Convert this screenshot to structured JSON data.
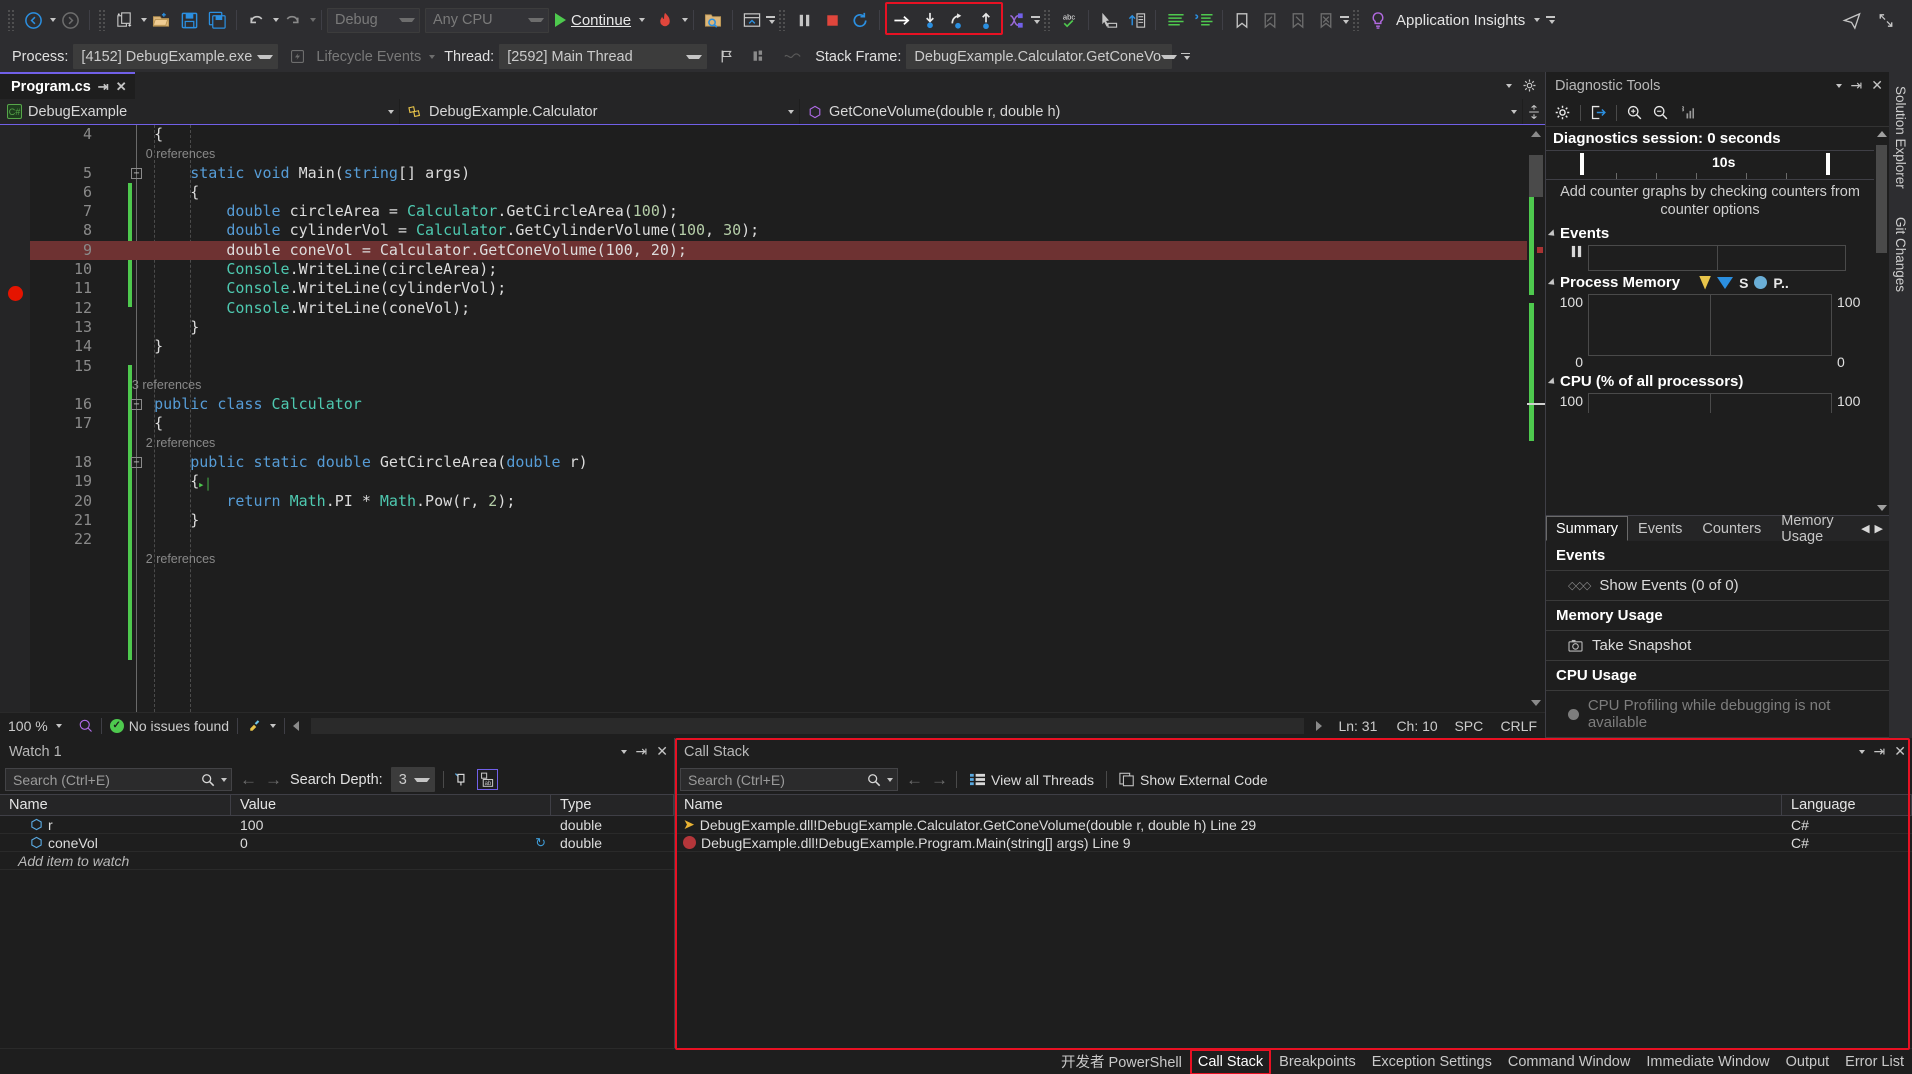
{
  "toolbar": {
    "nav_back_icon": "navigate-back-icon",
    "nav_forward_icon": "navigate-forward-icon",
    "new_item_icon": "new-item-icon",
    "open_file_icon": "open-file-icon",
    "save_icon": "save-icon",
    "save_all_icon": "save-all-icon",
    "undo_icon": "undo-icon",
    "redo_icon": "redo-icon",
    "config_value": "Debug",
    "platform_value": "Any CPU",
    "continue_label": "Continue",
    "hot_reload_icon": "hot-reload-icon",
    "folder_search_icon": "folder-search-icon",
    "window_layout_icon": "window-layout-icon",
    "break_all_icon": "break-all-icon",
    "stop_icon": "stop-debugging-icon",
    "restart_icon": "restart-icon",
    "step_into_specific_icon": "step-into-specific-icon",
    "step_into_icon": "step-into-icon",
    "step_over_icon": "step-over-icon",
    "step_out_icon": "step-out-icon",
    "threads_icon": "threads-icon",
    "spell_check_icon": "spell-check-icon",
    "select_icon": "select-icon",
    "compare_icon": "compare-icon",
    "indent_icon": "comment-icon",
    "uncomment_icon": "uncomment-icon",
    "bookmark_icon": "bookmark-icon",
    "prev_bookmark_icon": "previous-bookmark-icon",
    "next_bookmark_icon": "next-bookmark-icon",
    "clear_bookmark_icon": "clear-bookmarks-icon",
    "lightbulb_icon": "lightbulb-icon",
    "app_insights_label": "Application Insights",
    "feedback_icon": "send-feedback-icon",
    "maximize_icon": "maximize-icon"
  },
  "debug_location": {
    "process_label": "Process:",
    "process_value": "[4152] DebugExample.exe",
    "lifecycle_label": "Lifecycle Events",
    "lifecycle_icon": "lifecycle-events-icon",
    "thread_label": "Thread:",
    "thread_value": "[2592] Main Thread",
    "flag_icon": "flag-icon",
    "flag_group_icon": "flag-group-icon",
    "link_icon": "link-threads-icon",
    "stackframe_label": "Stack Frame:",
    "stackframe_value": "DebugExample.Calculator.GetConeVo"
  },
  "editor": {
    "tab_title": "Program.cs",
    "pin_icon": "pin-icon",
    "close_icon": "close-icon",
    "nav_project": "DebugExample",
    "nav_class": "DebugExample.Calculator",
    "nav_member": "GetConeVolume(double r, double h)",
    "class_icon": "csharp-project-icon",
    "method_icon": "method-icon",
    "member_icon": "member-icon",
    "split_icon": "split-window-icon",
    "lines": [
      {
        "num": "4",
        "indent": 0,
        "tokens": [
          {
            "t": "plain",
            "v": "    {"
          }
        ]
      },
      {
        "num": "",
        "indent": 0,
        "tokens": [
          {
            "t": "cref",
            "v": "        0 references"
          }
        ]
      },
      {
        "num": "5",
        "indent": 0,
        "fold": true,
        "tokens": [
          {
            "t": "kw",
            "v": "        static "
          },
          {
            "t": "kw",
            "v": "void "
          },
          {
            "t": "plain",
            "v": "Main("
          },
          {
            "t": "kw",
            "v": "string"
          },
          {
            "t": "plain",
            "v": "[] "
          },
          {
            "t": "plain",
            "v": "args)"
          }
        ]
      },
      {
        "num": "6",
        "indent": 0,
        "tokens": [
          {
            "t": "plain",
            "v": "        {"
          }
        ]
      },
      {
        "num": "7",
        "indent": 0,
        "tokens": [
          {
            "t": "kw",
            "v": "            double "
          },
          {
            "t": "plain",
            "v": "circleArea = "
          },
          {
            "t": "cls",
            "v": "Calculator"
          },
          {
            "t": "plain",
            "v": ".GetCircleArea("
          },
          {
            "t": "num-lit",
            "v": "100"
          },
          {
            "t": "plain",
            "v": ");"
          }
        ]
      },
      {
        "num": "8",
        "indent": 0,
        "tokens": [
          {
            "t": "kw",
            "v": "            double "
          },
          {
            "t": "plain",
            "v": "cylinderVol = "
          },
          {
            "t": "cls",
            "v": "Calculator"
          },
          {
            "t": "plain",
            "v": ".GetCylinderVolume("
          },
          {
            "t": "num-lit",
            "v": "100"
          },
          {
            "t": "plain",
            "v": ", "
          },
          {
            "t": "num-lit",
            "v": "30"
          },
          {
            "t": "plain",
            "v": ");"
          }
        ]
      },
      {
        "num": "9",
        "indent": 0,
        "highlight": true,
        "breakpoint": true,
        "tokens": [
          {
            "t": "plain",
            "v": "            double coneVol = Calculator.GetConeVolume(100, 20);"
          }
        ]
      },
      {
        "num": "10",
        "indent": 0,
        "tokens": [
          {
            "t": "cls",
            "v": "            Console"
          },
          {
            "t": "plain",
            "v": ".WriteLine(circleArea);"
          }
        ]
      },
      {
        "num": "11",
        "indent": 0,
        "tokens": [
          {
            "t": "cls",
            "v": "            Console"
          },
          {
            "t": "plain",
            "v": ".WriteLine(cylinderVol);"
          }
        ]
      },
      {
        "num": "12",
        "indent": 0,
        "tokens": [
          {
            "t": "cls",
            "v": "            Console"
          },
          {
            "t": "plain",
            "v": ".WriteLine(coneVol);"
          }
        ]
      },
      {
        "num": "13",
        "indent": 0,
        "tokens": [
          {
            "t": "plain",
            "v": "        }"
          }
        ]
      },
      {
        "num": "14",
        "indent": 0,
        "tokens": [
          {
            "t": "plain",
            "v": "    }"
          }
        ]
      },
      {
        "num": "15",
        "indent": 0,
        "tokens": [
          {
            "t": "plain",
            "v": ""
          }
        ]
      },
      {
        "num": "",
        "indent": 0,
        "tokens": [
          {
            "t": "cref",
            "v": "    3 references"
          }
        ]
      },
      {
        "num": "16",
        "indent": 0,
        "fold": true,
        "tokens": [
          {
            "t": "kw",
            "v": "    public class "
          },
          {
            "t": "type",
            "v": "Calculator"
          }
        ]
      },
      {
        "num": "17",
        "indent": 0,
        "tokens": [
          {
            "t": "plain",
            "v": "    {"
          }
        ]
      },
      {
        "num": "",
        "indent": 0,
        "tokens": [
          {
            "t": "cref",
            "v": "        2 references"
          }
        ]
      },
      {
        "num": "18",
        "indent": 0,
        "fold": true,
        "tokens": [
          {
            "t": "kw",
            "v": "        public static double "
          },
          {
            "t": "plain",
            "v": "GetCircleArea("
          },
          {
            "t": "kw",
            "v": "double "
          },
          {
            "t": "plain",
            "v": "r)"
          }
        ]
      },
      {
        "num": "19",
        "indent": 0,
        "greenarrow": true,
        "tokens": [
          {
            "t": "plain",
            "v": "        {"
          }
        ]
      },
      {
        "num": "20",
        "indent": 0,
        "tokens": [
          {
            "t": "kw",
            "v": "            return "
          },
          {
            "t": "cls",
            "v": "Math"
          },
          {
            "t": "plain",
            "v": ".PI * "
          },
          {
            "t": "cls",
            "v": "Math"
          },
          {
            "t": "plain",
            "v": ".Pow(r, "
          },
          {
            "t": "num-lit",
            "v": "2"
          },
          {
            "t": "plain",
            "v": ");"
          }
        ]
      },
      {
        "num": "21",
        "indent": 0,
        "tokens": [
          {
            "t": "plain",
            "v": "        }"
          }
        ]
      },
      {
        "num": "22",
        "indent": 0,
        "tokens": [
          {
            "t": "plain",
            "v": ""
          }
        ]
      },
      {
        "num": "",
        "indent": 0,
        "tokens": [
          {
            "t": "cref",
            "v": "        2 references"
          }
        ]
      }
    ],
    "status": {
      "zoom": "100 %",
      "zoom_icon": "zoom-level-icon",
      "issues_icon": "no-issues-icon",
      "issues_text": "No issues found",
      "brush_icon": "code-cleanup-icon",
      "line_label": "Ln: 31",
      "char_label": "Ch: 10",
      "spaces_label": "SPC",
      "eol_label": "CRLF"
    }
  },
  "diagnostics": {
    "title": "Diagnostic Tools",
    "dropdown_icon": "window-dropdown-icon",
    "pin_icon": "pin-icon",
    "close_icon": "close-icon",
    "settings_icon": "gear-icon",
    "export_icon": "export-icon",
    "zoom_in_icon": "zoom-in-icon",
    "zoom_out_icon": "zoom-out-icon",
    "counters_icon": "counter-graph-icon",
    "session_label": "Diagnostics session: 0 seconds",
    "timeline_label": "10s",
    "hint": "Add counter graphs by checking counters from counter options",
    "events_section": "Events",
    "events_pause_icon": "pause-icon",
    "memory_section": "Process Memory",
    "memory_legend": [
      {
        "icon": "yellow-marker-icon",
        "label": ""
      },
      {
        "icon": "blue-triangle-icon",
        "label": "S"
      },
      {
        "icon": "blue-circle-icon",
        "label": "P.."
      }
    ],
    "memory_axis_top_left": "100",
    "memory_axis_top_right": "100",
    "memory_axis_bottom_left": "0",
    "memory_axis_bottom_right": "0",
    "cpu_section": "CPU (% of all processors)",
    "cpu_axis_top_left": "100",
    "cpu_axis_top_right": "100",
    "tabs": [
      {
        "label": "Summary",
        "active": true
      },
      {
        "label": "Events",
        "active": false
      },
      {
        "label": "Counters",
        "active": false
      },
      {
        "label": "Memory Usage",
        "active": false
      }
    ],
    "tab_prev_icon": "scroll-left-icon",
    "tab_next_icon": "scroll-right-icon",
    "summary": {
      "events_head": "Events",
      "show_events": "Show Events (0 of 0)",
      "show_events_icon": "events-icon",
      "memory_head": "Memory Usage",
      "take_snapshot": "Take Snapshot",
      "snapshot_icon": "camera-icon",
      "cpu_head": "CPU Usage",
      "cpu_note": "CPU Profiling while debugging is not available",
      "cpu_note_icon": "bullet-icon"
    }
  },
  "rail": {
    "items": [
      {
        "label": "Solution Explorer"
      },
      {
        "label": "Git Changes"
      }
    ]
  },
  "watch": {
    "title": "Watch 1",
    "dropdown_icon": "window-dropdown-icon",
    "pin_icon": "pin-icon",
    "close_icon": "close-icon",
    "search_placeholder": "Search (Ctrl+E)",
    "search_icon": "search-icon",
    "prev_icon": "search-previous-icon",
    "next_icon": "search-next-icon",
    "depth_label": "Search Depth:",
    "depth_value": "3",
    "pin_col_icon": "pin-column-icon",
    "hex_icon": "hexadecimal-display-icon",
    "columns": [
      "Name",
      "Value",
      "Type"
    ],
    "rows": [
      {
        "icon": "variable-icon",
        "name": "r",
        "value": "100",
        "type": "double",
        "refresh": false
      },
      {
        "icon": "variable-icon",
        "name": "coneVol",
        "value": "0",
        "type": "double",
        "refresh": true
      }
    ],
    "add_row_placeholder": "Add item to watch"
  },
  "callstack": {
    "title": "Call Stack",
    "dropdown_icon": "window-dropdown-icon",
    "pin_icon": "pin-icon",
    "close_icon": "close-icon",
    "search_placeholder": "Search (Ctrl+E)",
    "search_icon": "search-icon",
    "prev_icon": "search-previous-icon",
    "next_icon": "search-next-icon",
    "view_all_threads": "View all Threads",
    "view_all_threads_icon": "threads-icon",
    "show_external_code": "Show External Code",
    "show_external_code_icon": "external-code-icon",
    "columns": [
      "Name",
      "Language"
    ],
    "rows": [
      {
        "marker": "current-frame-icon",
        "name": "DebugExample.dll!DebugExample.Calculator.GetConeVolume(double r, double h) Line 29",
        "language": "C#"
      },
      {
        "marker": "breakpoint-frame-icon",
        "name": "DebugExample.dll!DebugExample.Program.Main(string[] args) Line 9",
        "language": "C#"
      }
    ]
  },
  "bottom_tabs": [
    {
      "label": "开发者 PowerShell",
      "active": false
    },
    {
      "label": "Call Stack",
      "active": true
    },
    {
      "label": "Breakpoints",
      "active": false
    },
    {
      "label": "Exception Settings",
      "active": false
    },
    {
      "label": "Command Window",
      "active": false
    },
    {
      "label": "Immediate Window",
      "active": false
    },
    {
      "label": "Output",
      "active": false
    },
    {
      "label": "Error List",
      "active": false
    }
  ],
  "colors": {
    "accent_purple": "#7160e8",
    "highlight_red": "#e81123",
    "breakpoint_red": "#e51400",
    "change_green": "#4ec94e",
    "line_highlight": "#6e3232"
  }
}
